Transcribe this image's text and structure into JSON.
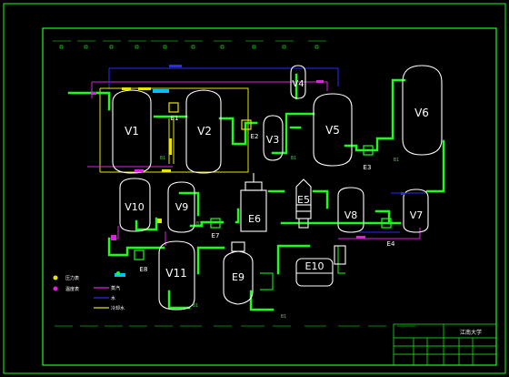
{
  "vessels": [
    {
      "id": "v1",
      "label": "V1"
    },
    {
      "id": "v2",
      "label": "V2"
    },
    {
      "id": "v3",
      "label": "V3"
    },
    {
      "id": "v4",
      "label": "V4"
    },
    {
      "id": "v5",
      "label": "V5"
    },
    {
      "id": "v6",
      "label": "V6"
    },
    {
      "id": "v7",
      "label": "V7"
    },
    {
      "id": "v8",
      "label": "V8"
    },
    {
      "id": "v9",
      "label": "V9"
    },
    {
      "id": "v10",
      "label": "V10"
    },
    {
      "id": "v11",
      "label": "V11"
    },
    {
      "id": "e5",
      "label": "E5"
    },
    {
      "id": "e6",
      "label": "E6"
    },
    {
      "id": "e9",
      "label": "E9"
    },
    {
      "id": "e10",
      "label": "E10"
    }
  ],
  "exchangers": [
    {
      "id": "e1",
      "label": "E1"
    },
    {
      "id": "e2",
      "label": "E2"
    },
    {
      "id": "e3",
      "label": "E3"
    },
    {
      "id": "e4",
      "label": "E4"
    },
    {
      "id": "e7",
      "label": "E7"
    },
    {
      "id": "e8",
      "label": "E8"
    }
  ],
  "pump_label": "B1",
  "legend": [
    {
      "symbol": "压力表",
      "color": "#e6e600"
    },
    {
      "symbol": "温度表",
      "color": "#e020e0"
    },
    {
      "symbol": "蒸汽",
      "color": "#e020e0"
    },
    {
      "symbol": "水",
      "color": "#2a2aff"
    },
    {
      "symbol": "冷却水",
      "color": "#e6e600"
    }
  ],
  "title_block": {
    "school": "江南大学"
  },
  "colors": {
    "process": "#1aff1a",
    "steam": "#e020e0",
    "water": "#2a2aff",
    "cooling": "#e6e600",
    "vessel": "#ffffff",
    "accent": "#00bfff"
  }
}
